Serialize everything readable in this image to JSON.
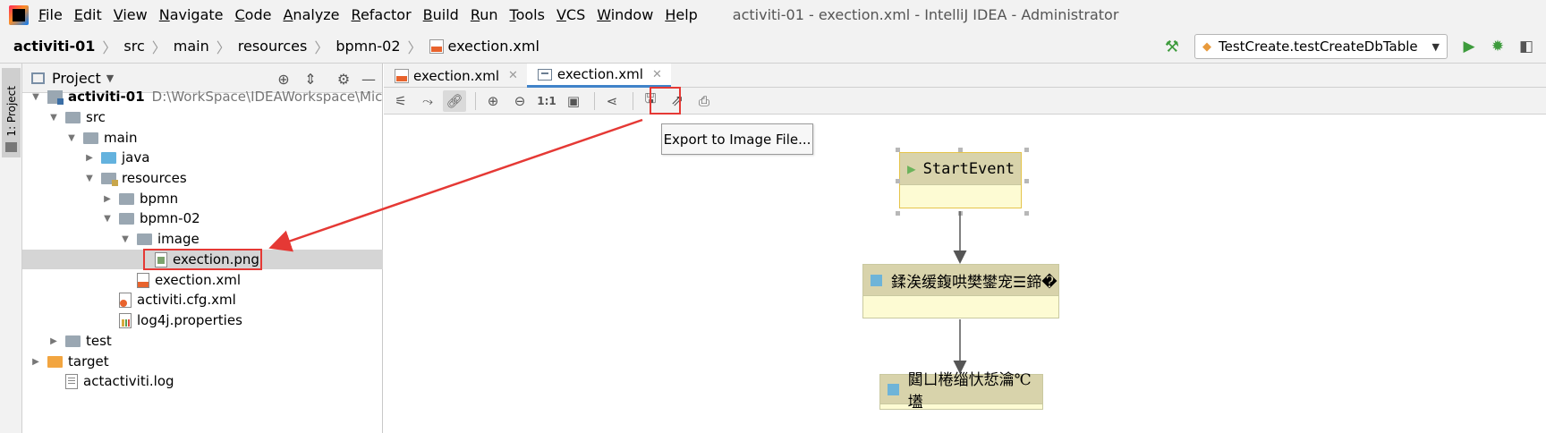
{
  "menu": {
    "items": [
      "File",
      "Edit",
      "View",
      "Navigate",
      "Code",
      "Analyze",
      "Refactor",
      "Build",
      "Run",
      "Tools",
      "VCS",
      "Window",
      "Help"
    ],
    "window_title": "activiti-01 - exection.xml - IntelliJ IDEA - Administrator"
  },
  "breadcrumb": [
    "activiti-01",
    "src",
    "main",
    "resources",
    "bpmn-02",
    "exection.xml"
  ],
  "run_config": {
    "label": "TestCreate.testCreateDbTable"
  },
  "left_strip": {
    "project_tab": "1: Project"
  },
  "project_panel": {
    "title": "Project",
    "tree": [
      {
        "label": "activiti-01",
        "path": "D:\\WorkSpace\\IDEAWorkspace\\Microservic",
        "kind": "module",
        "arrow": "down"
      },
      {
        "label": "src",
        "kind": "folder",
        "arrow": "down"
      },
      {
        "label": "main",
        "kind": "folder",
        "arrow": "down"
      },
      {
        "label": "java",
        "kind": "folder-blue",
        "arrow": "right"
      },
      {
        "label": "resources",
        "kind": "folder-res",
        "arrow": "down"
      },
      {
        "label": "bpmn",
        "kind": "folder",
        "arrow": "right"
      },
      {
        "label": "bpmn-02",
        "kind": "folder",
        "arrow": "down"
      },
      {
        "label": "image",
        "kind": "folder",
        "arrow": "down"
      },
      {
        "label": "exection.png",
        "kind": "png",
        "selected": true
      },
      {
        "label": "exection.xml",
        "kind": "xml"
      },
      {
        "label": "activiti.cfg.xml",
        "kind": "cfg"
      },
      {
        "label": "log4j.properties",
        "kind": "prop"
      },
      {
        "label": "test",
        "kind": "folder",
        "arrow": "right"
      },
      {
        "label": "target",
        "kind": "folder-orange",
        "arrow": "right"
      },
      {
        "label": "actactiviti.log",
        "kind": "log"
      }
    ]
  },
  "editor_tabs": [
    {
      "label": "exection.xml",
      "active": false
    },
    {
      "label": "exection.xml",
      "active": true
    }
  ],
  "tooltip": {
    "text": "Export to Image File..."
  },
  "diagram": {
    "start_event": "StartEvent",
    "task1": "鍒涘缓鍑哄樊鐢宠☰鍗�",
    "task2": "閮ㄩ棬缁忕悊瀹℃壒"
  },
  "colors": {
    "annotation_red": "#e53935",
    "accent_blue": "#4083c9"
  }
}
